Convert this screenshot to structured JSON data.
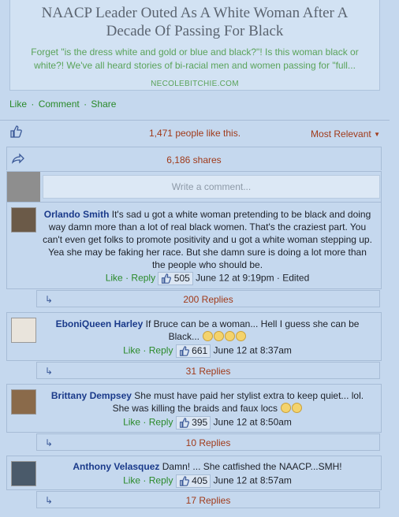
{
  "link": {
    "title": "NAACP Leader Outed As A White Woman After A Decade Of Passing For Black",
    "description": "Forget \"is the dress white and gold or blue and black?\"! Is this woman black or white?! We've all heard stories of bi-racial men and women passing for \"full...",
    "domain": "NECOLEBITCHIE.COM"
  },
  "actions": {
    "like": "Like",
    "comment": "Comment",
    "share": "Share",
    "sep": "·"
  },
  "likes_summary": "1,471 people like this.",
  "sort_label": "Most Relevant",
  "shares_summary": "6,186 shares",
  "write_placeholder": "Write a comment...",
  "comments": [
    {
      "name": "Orlando Smith",
      "text": "It's sad u got a white woman pretending to be black and doing way damn more than a lot of real black women. That's the craziest part. You can't even get folks to promote positivity and u got a white woman stepping up. Yea she may be faking her race. But she damn sure is doing a lot more than the people who should be.",
      "like": "Like",
      "reply": "Reply",
      "likes": "505",
      "time": "June 12 at 9:19pm",
      "edited": "Edited",
      "replies": "200 Replies"
    },
    {
      "name": "EboniQueen Harley",
      "text": "If Bruce can be a woman... Hell I guess she can be Black...",
      "like": "Like",
      "reply": "Reply",
      "likes": "661",
      "time": "June 12 at 8:37am",
      "replies": "31 Replies"
    },
    {
      "name": "Brittany Dempsey",
      "text": "She must have paid her stylist extra to keep quiet... lol. She was killing the braids and faux locs",
      "like": "Like",
      "reply": "Reply",
      "likes": "395",
      "time": "June 12 at 8:50am",
      "replies": "10 Replies"
    },
    {
      "name": "Anthony Velasquez",
      "text": "Damn! ... She catfished the NAACP...SMH!",
      "like": "Like",
      "reply": "Reply",
      "likes": "405",
      "time": "June 12 at 8:57am",
      "replies": "17 Replies"
    }
  ],
  "colors": {
    "accent": "#3b5998",
    "green": "#2a8a2a",
    "count": "#a03a1a",
    "background": "#c5d8ee"
  }
}
